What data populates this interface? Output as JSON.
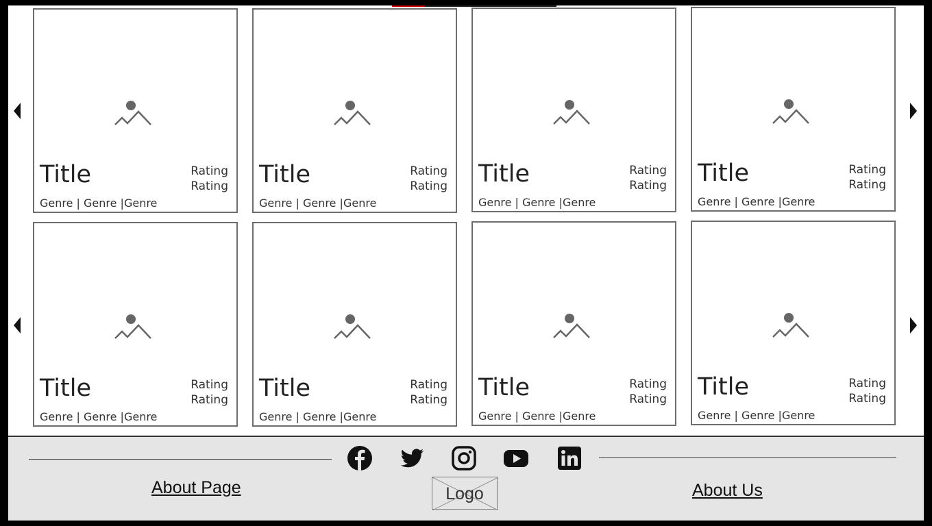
{
  "carousel": {
    "rows": [
      {
        "cards": [
          {
            "title": "Title",
            "rating_1": "Rating",
            "rating_2": "Rating",
            "genres": "Genre | Genre |Genre"
          },
          {
            "title": "Title",
            "rating_1": "Rating",
            "rating_2": "Rating",
            "genres": "Genre | Genre |Genre"
          },
          {
            "title": "Title",
            "rating_1": "Rating",
            "rating_2": "Rating",
            "genres": "Genre | Genre |Genre"
          },
          {
            "title": "Title",
            "rating_1": "Rating",
            "rating_2": "Rating",
            "genres": "Genre | Genre |Genre"
          }
        ]
      },
      {
        "cards": [
          {
            "title": "Title",
            "rating_1": "Rating",
            "rating_2": "Rating",
            "genres": "Genre | Genre |Genre"
          },
          {
            "title": "Title",
            "rating_1": "Rating",
            "rating_2": "Rating",
            "genres": "Genre | Genre |Genre"
          },
          {
            "title": "Title",
            "rating_1": "Rating",
            "rating_2": "Rating",
            "genres": "Genre | Genre |Genre"
          },
          {
            "title": "Title",
            "rating_1": "Rating",
            "rating_2": "Rating",
            "genres": "Genre | Genre |Genre"
          }
        ]
      }
    ],
    "icons": {
      "prev": "triangle-left-icon",
      "next": "triangle-right-icon",
      "placeholder": "image-placeholder-icon"
    }
  },
  "footer": {
    "about_page_label": "About Page",
    "about_us_label": "About Us",
    "logo_label": "Logo",
    "social_icons": [
      "facebook-icon",
      "twitter-icon",
      "instagram-icon",
      "youtube-icon",
      "linkedin-icon"
    ]
  },
  "colors": {
    "card_border": "#6d6d6d",
    "footer_background": "#e5e5e5",
    "icon_gray": "#666666",
    "accent_red": "#cc0000"
  }
}
